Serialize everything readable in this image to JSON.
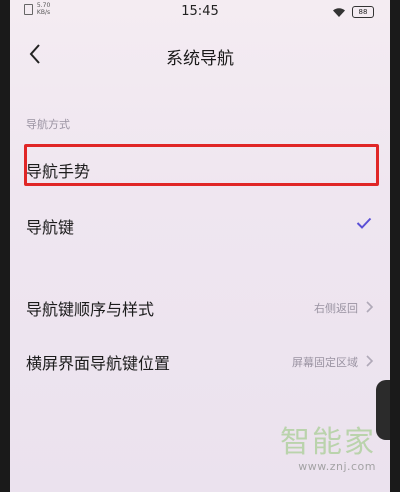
{
  "status_bar": {
    "signal_text": "5.70\nKB/s",
    "time": "15:45",
    "battery": "88"
  },
  "header": {
    "title": "系统导航"
  },
  "section": {
    "label": "导航方式"
  },
  "rows": [
    {
      "label": "导航手势",
      "value": ""
    },
    {
      "label": "导航键",
      "value": "",
      "checked": true
    },
    {
      "label": "导航键顺序与样式",
      "value": "右侧返回"
    },
    {
      "label": "横屏界面导航键位置",
      "value": "屏幕固定区域"
    }
  ],
  "watermark": {
    "logo": "智能家",
    "url": "www.znj.com"
  },
  "colors": {
    "highlight": "#e02626",
    "accent": "#5a4fd6",
    "secondary_text": "#9a93a2"
  }
}
